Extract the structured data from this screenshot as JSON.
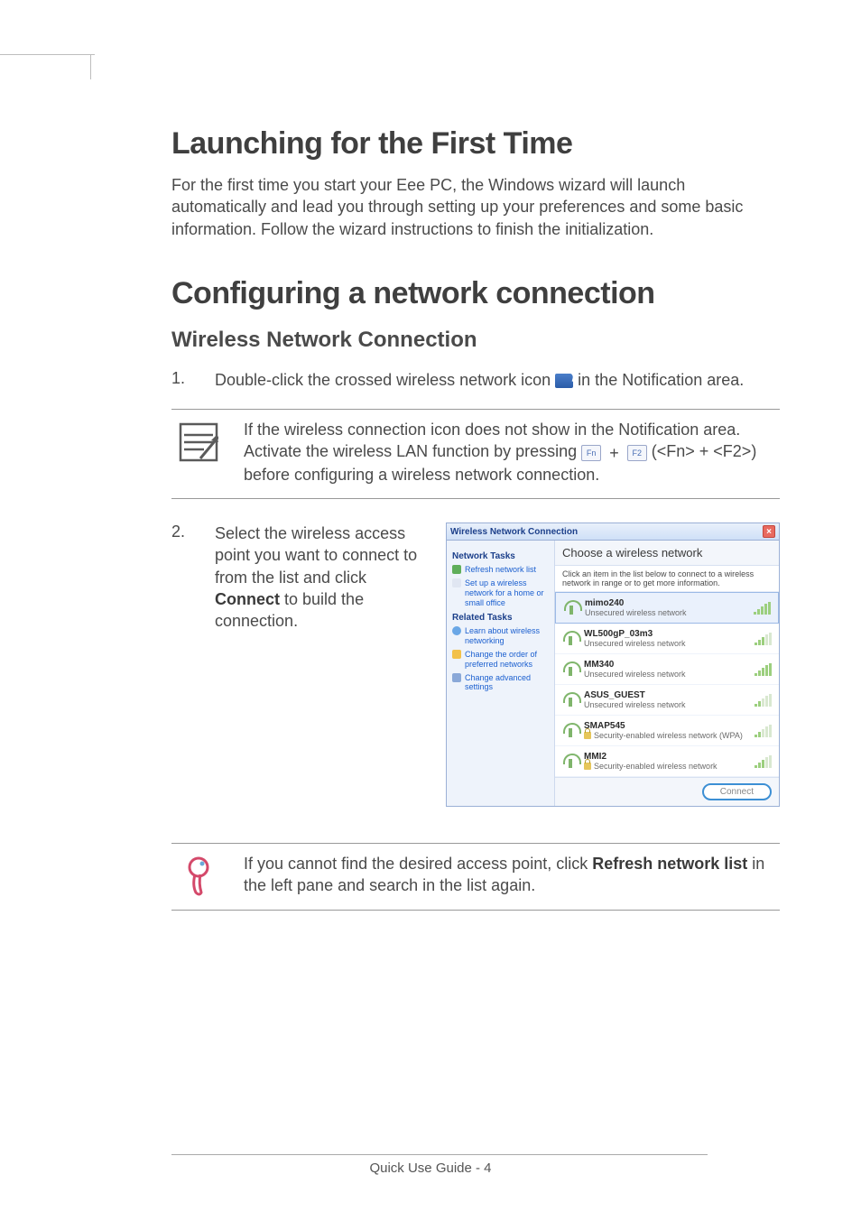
{
  "headings": {
    "h1a": "Launching for the First Time",
    "h1b": "Configuring a network connection",
    "h2": "Wireless Network Connection"
  },
  "paragraphs": {
    "intro": "For the first time you start your Eee PC, the Windows wizard will launch automatically and lead you through setting up your preferences and some basic information. Follow the wizard instructions to finish the initialization."
  },
  "steps": {
    "s1_num": "1.",
    "s1_a": "Double-click the crossed wireless network icon ",
    "s1_b": " in the Notification area.",
    "s2_num": "2.",
    "s2_a": "Select the wireless access point you want to connect to from the list and click ",
    "s2_bold": "Connect",
    "s2_b": " to build the connection."
  },
  "note1": {
    "a": "If the wireless connection icon does not show in the Notification area. Activate the wireless LAN function by pressing ",
    "key1": "Fn",
    "plus": "+",
    "key2": "F2",
    "b": " (<Fn> + <F2>) before configuring a wireless network connection."
  },
  "note2": {
    "a": "If you cannot find the desired access point, click ",
    "bold": "Refresh network list",
    "b": " in the left pane and search in the list again."
  },
  "win": {
    "title": "Wireless Network Connection",
    "side": {
      "head1": "Network Tasks",
      "link1": "Refresh network list",
      "link2": "Set up a wireless network for a home or small office",
      "head2": "Related Tasks",
      "link3": "Learn about wireless networking",
      "link4": "Change the order of preferred networks",
      "link5": "Change advanced settings"
    },
    "main": {
      "choose": "Choose a wireless network",
      "sub": "Click an item in the list below to connect to a wireless network in range or to get more information.",
      "items": [
        {
          "name": "mimo240",
          "sub": "Unsecured wireless network",
          "sec": false,
          "sig": "full",
          "sel": true
        },
        {
          "name": "WL500gP_03m3",
          "sub": "Unsecured wireless network",
          "sec": false,
          "sig": "mid",
          "sel": false
        },
        {
          "name": "MM340",
          "sub": "Unsecured wireless network",
          "sec": false,
          "sig": "full",
          "sel": false
        },
        {
          "name": "ASUS_GUEST",
          "sub": "Unsecured wireless network",
          "sec": false,
          "sig": "weak",
          "sel": false
        },
        {
          "name": "SMAP545",
          "sub": "Security-enabled wireless network (WPA)",
          "sec": true,
          "sig": "weak",
          "sel": false
        },
        {
          "name": "MMI2",
          "sub": "Security-enabled wireless network",
          "sec": true,
          "sig": "mid",
          "sel": false
        }
      ],
      "connect": "Connect"
    }
  },
  "footer": "Quick Use Guide - 4"
}
